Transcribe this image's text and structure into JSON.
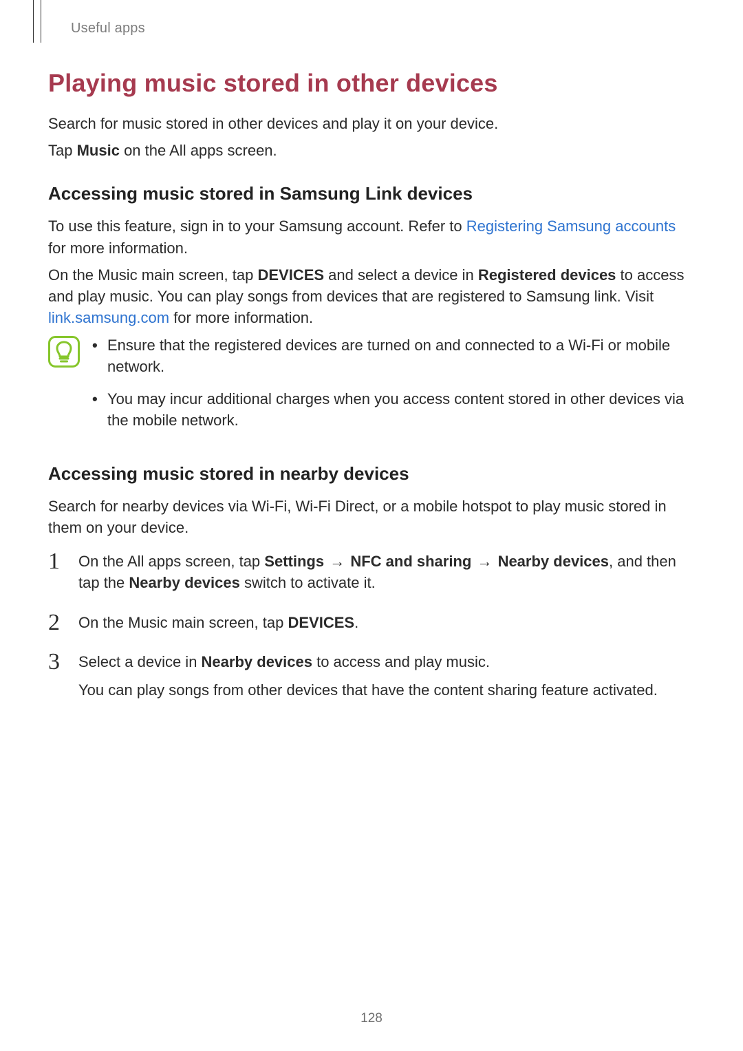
{
  "header": {
    "running_head": "Useful apps"
  },
  "title": "Playing music stored in other devices",
  "intro": {
    "p1": "Search for music stored in other devices and play it on your device.",
    "p2_pre": "Tap ",
    "p2_bold": "Music",
    "p2_post": " on the All apps screen."
  },
  "samsung_link": {
    "heading": "Accessing music stored in Samsung Link devices",
    "p1_pre": "To use this feature, sign in to your Samsung account. Refer to ",
    "p1_link": "Registering Samsung accounts",
    "p1_post": " for more information.",
    "p2_a": "On the Music main screen, tap ",
    "p2_b_bold": "DEVICES",
    "p2_c": " and select a device in ",
    "p2_d_bold": "Registered devices",
    "p2_e": " to access and play music. You can play songs from devices that are registered to Samsung link. Visit ",
    "p2_link": "link.samsung.com",
    "p2_f": " for more information.",
    "notes": [
      "Ensure that the registered devices are turned on and connected to a Wi-Fi or mobile network.",
      "You may incur additional charges when you access content stored in other devices via the mobile network."
    ]
  },
  "nearby": {
    "heading": "Accessing music stored in nearby devices",
    "intro": "Search for nearby devices via Wi-Fi, Wi-Fi Direct, or a mobile hotspot to play music stored in them on your device.",
    "steps": {
      "s1": {
        "a": "On the All apps screen, tap ",
        "b_bold": "Settings",
        "arrow1": " → ",
        "c_bold": "NFC and sharing",
        "arrow2": " → ",
        "d_bold": "Nearby devices",
        "e": ", and then tap the ",
        "f_bold": "Nearby devices",
        "g": " switch to activate it."
      },
      "s2": {
        "a": "On the Music main screen, tap ",
        "b_bold": "DEVICES",
        "c": "."
      },
      "s3": {
        "a": "Select a device in ",
        "b_bold": "Nearby devices",
        "c": " to access and play music.",
        "p2": "You can play songs from other devices that have the content sharing feature activated."
      }
    }
  },
  "page_number": "128",
  "step_numbers": {
    "n1": "1",
    "n2": "2",
    "n3": "3"
  }
}
